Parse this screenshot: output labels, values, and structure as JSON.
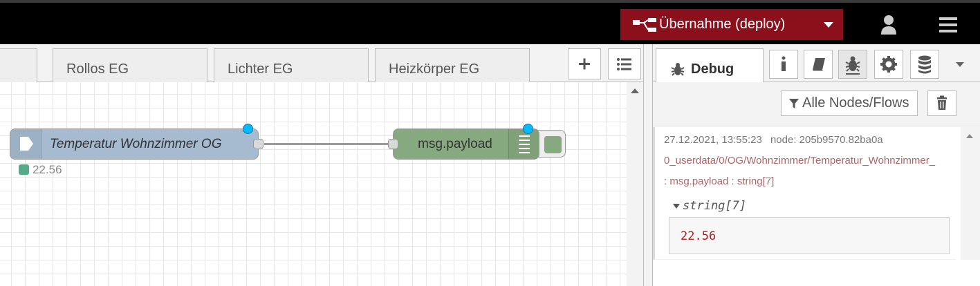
{
  "header": {
    "deploy_label": "Übernahme (deploy)"
  },
  "workspace": {
    "tabs": [
      {
        "label": ""
      },
      {
        "label": "Rollos EG"
      },
      {
        "label": "Lichter EG"
      },
      {
        "label": "Heizkörper EG"
      }
    ],
    "nodes": {
      "inject": {
        "label": "Temperatur Wohnzimmer OG",
        "status": "22.56"
      },
      "debug": {
        "label": "msg.payload"
      }
    }
  },
  "sidebar": {
    "active_tab": "Debug",
    "filter_label": "Alle Nodes/Flows",
    "message": {
      "timestamp": "27.12.2021, 13:55:23",
      "node": "node: 205b9570.82ba0a",
      "topic": "0_userdata/0/OG/Wohnzimmer/Temperatur_Wohnzimmer_",
      "type": ": msg.payload : string[7]",
      "expander": "string[7]",
      "value": "22.56"
    }
  },
  "colors": {
    "deploy": "#8c101c",
    "inject_node": "#a6bbcf",
    "debug_node": "#87a980",
    "changed_dot": "#00bcff"
  }
}
